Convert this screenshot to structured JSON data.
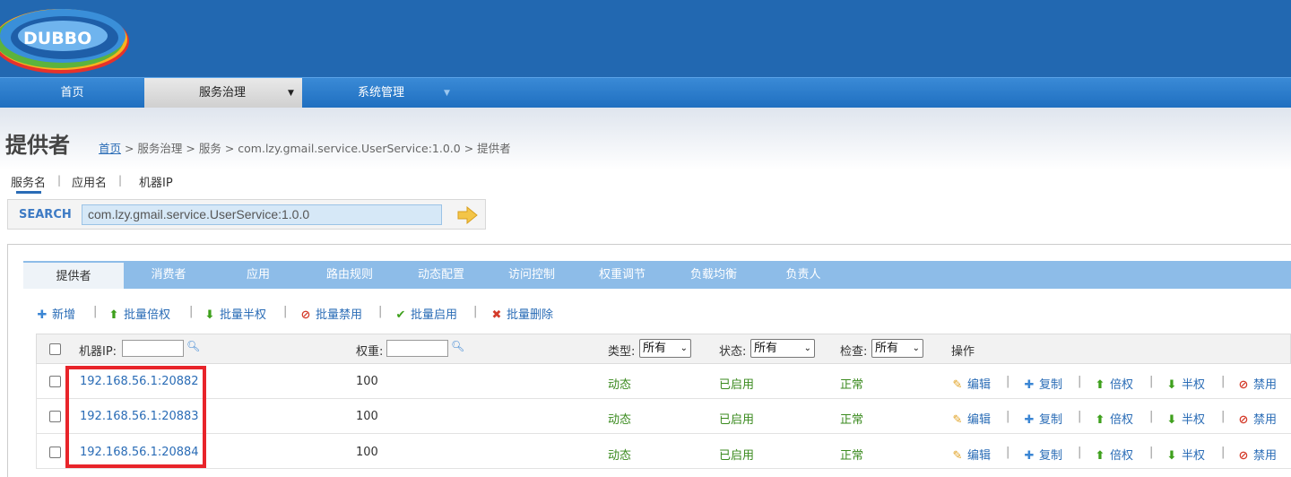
{
  "header": {
    "logo_text": "DUBBO"
  },
  "nav": {
    "items": [
      {
        "label": "首页"
      },
      {
        "label": "服务治理"
      },
      {
        "label": "系统管理"
      }
    ],
    "caret": "▼"
  },
  "page": {
    "title": "提供者",
    "breadcrumb": {
      "home": "首页",
      "rest": " > 服务治理 > 服务 > com.lzy.gmail.service.UserService:1.0.0 > 提供者"
    }
  },
  "search": {
    "tabs": [
      "服务名",
      "应用名",
      "机器IP"
    ],
    "label": "SEARCH",
    "value": "com.lzy.gmail.service.UserService:1.0.0"
  },
  "tabs": [
    "提供者",
    "消费者",
    "应用",
    "路由规则",
    "动态配置",
    "访问控制",
    "权重调节",
    "负载均衡",
    "负责人"
  ],
  "toolbar": {
    "add": "新增",
    "batch_double": "批量倍权",
    "batch_half": "批量半权",
    "batch_disable": "批量禁用",
    "batch_enable": "批量启用",
    "batch_delete": "批量删除"
  },
  "table": {
    "headers": {
      "ip": "机器IP:",
      "weight": "权重:",
      "type": "类型:",
      "status": "状态:",
      "check": "检查:",
      "ops": "操作"
    },
    "filters": {
      "type": "所有",
      "status": "所有",
      "check": "所有"
    },
    "rows": [
      {
        "ip": "192.168.56.1:20882",
        "weight": "100",
        "type": "动态",
        "status": "已启用",
        "check": "正常"
      },
      {
        "ip": "192.168.56.1:20883",
        "weight": "100",
        "type": "动态",
        "status": "已启用",
        "check": "正常"
      },
      {
        "ip": "192.168.56.1:20884",
        "weight": "100",
        "type": "动态",
        "status": "已启用",
        "check": "正常"
      }
    ],
    "ops": {
      "edit": "编辑",
      "copy": "复制",
      "double": "倍权",
      "half": "半权",
      "disable": "禁用"
    }
  },
  "colors": {
    "header_bg": "#2268b1",
    "tab_bar": "#8dbce8",
    "link": "#2a6cb6",
    "ok_green": "#3a8a1e",
    "highlight_border": "#e8242a"
  }
}
